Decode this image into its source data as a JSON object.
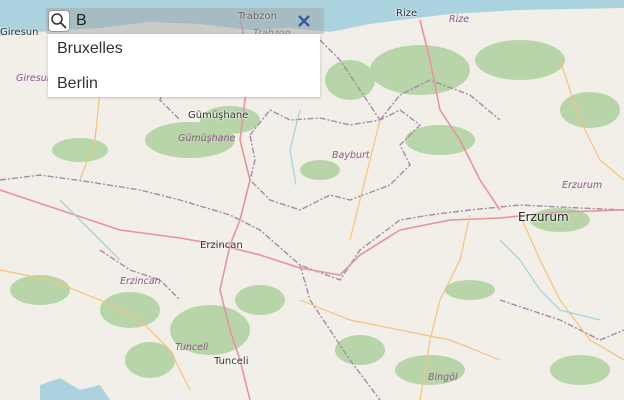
{
  "search": {
    "query": "B",
    "results": [
      "Bruxelles",
      "Berlin"
    ]
  },
  "map_labels": {
    "cities": [
      "Rize",
      "Trabzon",
      "Giresun",
      "Gumushane",
      "Bayburt",
      "Erzurum",
      "Erzincan",
      "Tunceli"
    ],
    "city_display": {
      "rize": "Rize",
      "trabzon": "Trabzon",
      "giresun": "Giresun",
      "gumushane": "Gümüşhane",
      "erzincan": "Erzincan",
      "tunceli": "Tunceli",
      "erzurum": "Erzurum"
    },
    "province_display": {
      "rize": "Rize",
      "trabzon": "Trabzon",
      "giresun": "Giresun",
      "gumushane": "Gümüşhane",
      "bayburt": "Bayburt",
      "erzurum": "Erzurum",
      "erzincan": "Erzincan",
      "tunceli": "Tunceli",
      "bingol": "Bingöl"
    }
  },
  "colors": {
    "sea": "#aad3df",
    "land": "#f2efe9",
    "forest": "#add19e",
    "boundary": "#a58aa8",
    "major_road": "#e892a2",
    "minor_road": "#f6c27a",
    "clear_x": "#3a5a9a"
  },
  "icons": [
    "search-icon",
    "clear-icon"
  ]
}
